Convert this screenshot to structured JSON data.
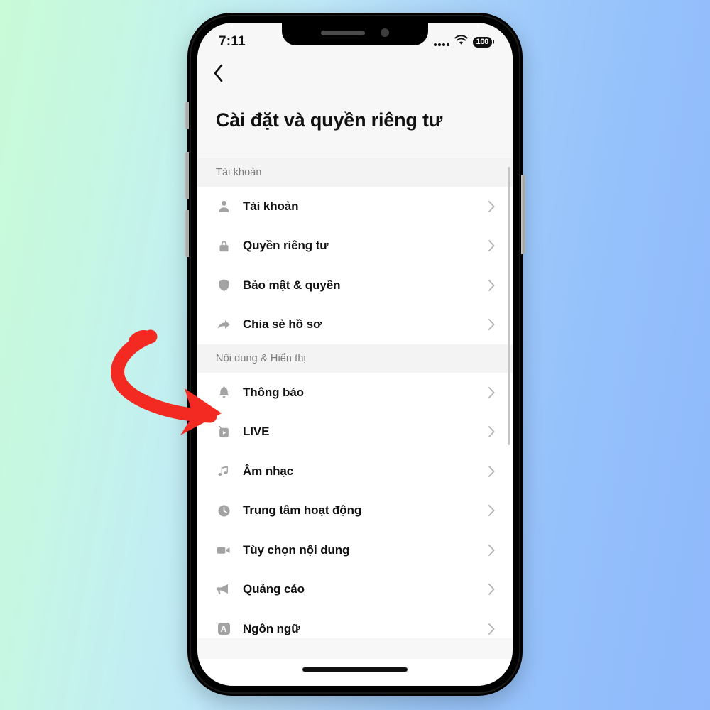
{
  "background": {
    "gradient_from": "#c9fbd8",
    "gradient_to": "#8fb9fb"
  },
  "annotation": {
    "type": "curved-arrow",
    "color": "#f22a22",
    "points_at": "Thông báo"
  },
  "phone": {
    "status_bar": {
      "time": "7:11",
      "battery_percent": "100",
      "cellular_icon": "cellular-dots-icon",
      "wifi_icon": "wifi-icon",
      "battery_icon": "battery-icon"
    },
    "nav": {
      "back_icon": "chevron-left-icon"
    },
    "page_title": "Cài đặt và quyền riêng tư",
    "sections": [
      {
        "header": "Tài khoản",
        "items": [
          {
            "icon": "person-icon",
            "label": "Tài khoản",
            "chevron": "chevron-right-icon"
          },
          {
            "icon": "lock-icon",
            "label": "Quyền riêng tư",
            "chevron": "chevron-right-icon"
          },
          {
            "icon": "shield-icon",
            "label": "Bảo mật & quyền",
            "chevron": "chevron-right-icon"
          },
          {
            "icon": "share-icon",
            "label": "Chia sẻ hồ sơ",
            "chevron": "chevron-right-icon"
          }
        ]
      },
      {
        "header": "Nội dung & Hiển thị",
        "items": [
          {
            "icon": "bell-icon",
            "label": "Thông báo",
            "chevron": "chevron-right-icon"
          },
          {
            "icon": "live-tv-icon",
            "label": "LIVE",
            "chevron": "chevron-right-icon"
          },
          {
            "icon": "music-icon",
            "label": "Âm nhạc",
            "chevron": "chevron-right-icon"
          },
          {
            "icon": "clock-icon",
            "label": "Trung tâm hoạt động",
            "chevron": "chevron-right-icon"
          },
          {
            "icon": "video-icon",
            "label": "Tùy chọn nội dung",
            "chevron": "chevron-right-icon"
          },
          {
            "icon": "megaphone-icon",
            "label": "Quảng cáo",
            "chevron": "chevron-right-icon"
          },
          {
            "icon": "language-icon",
            "label": "Ngôn ngữ",
            "chevron": "chevron-right-icon",
            "badge_letter": "A"
          }
        ]
      }
    ]
  }
}
